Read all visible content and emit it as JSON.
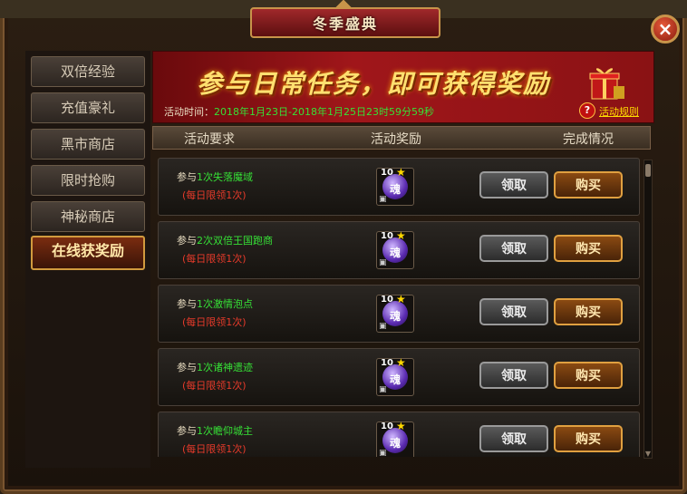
{
  "window": {
    "title": "冬季盛典",
    "close_label": "×"
  },
  "sidebar": {
    "items": [
      {
        "label": "双倍经验"
      },
      {
        "label": "充值豪礼"
      },
      {
        "label": "黑市商店"
      },
      {
        "label": "限时抢购"
      },
      {
        "label": "神秘商店"
      },
      {
        "label": "在线获奖励"
      }
    ],
    "active_index": 5
  },
  "banner": {
    "title": "参与日常任务，即可获得奖励",
    "time_label": "活动时间：",
    "time_value": "2018年1月23日-2018年1月25日23时59分59秒",
    "rules_label": "活动规则",
    "help_glyph": "?"
  },
  "columns": {
    "requirement": "活动要求",
    "reward": "活动奖励",
    "status": "完成情况"
  },
  "rows": [
    {
      "req_prefix": "参与",
      "req_task": "1次失落魔域",
      "limit": "(每日限领1次)",
      "item_count": "10",
      "item_glyph": "魂",
      "claim": "领取",
      "buy": "购买"
    },
    {
      "req_prefix": "参与",
      "req_task": "2次双倍王国跑商",
      "limit": "(每日限领1次)",
      "item_count": "10",
      "item_glyph": "魂",
      "claim": "领取",
      "buy": "购买"
    },
    {
      "req_prefix": "参与",
      "req_task": "1次激情泡点",
      "limit": "(每日限领1次)",
      "item_count": "10",
      "item_glyph": "魂",
      "claim": "领取",
      "buy": "购买"
    },
    {
      "req_prefix": "参与",
      "req_task": "1次诸神遗迹",
      "limit": "(每日限领1次)",
      "item_count": "10",
      "item_glyph": "魂",
      "claim": "领取",
      "buy": "购买"
    },
    {
      "req_prefix": "参与",
      "req_task": "1次瞻仰城主",
      "limit": "(每日限领1次)",
      "item_count": "10",
      "item_glyph": "魂",
      "claim": "领取",
      "buy": "购买"
    }
  ],
  "colors": {
    "highlight_green": "#36e036",
    "limit_red": "#e53a2a",
    "gold": "#ffe070"
  }
}
